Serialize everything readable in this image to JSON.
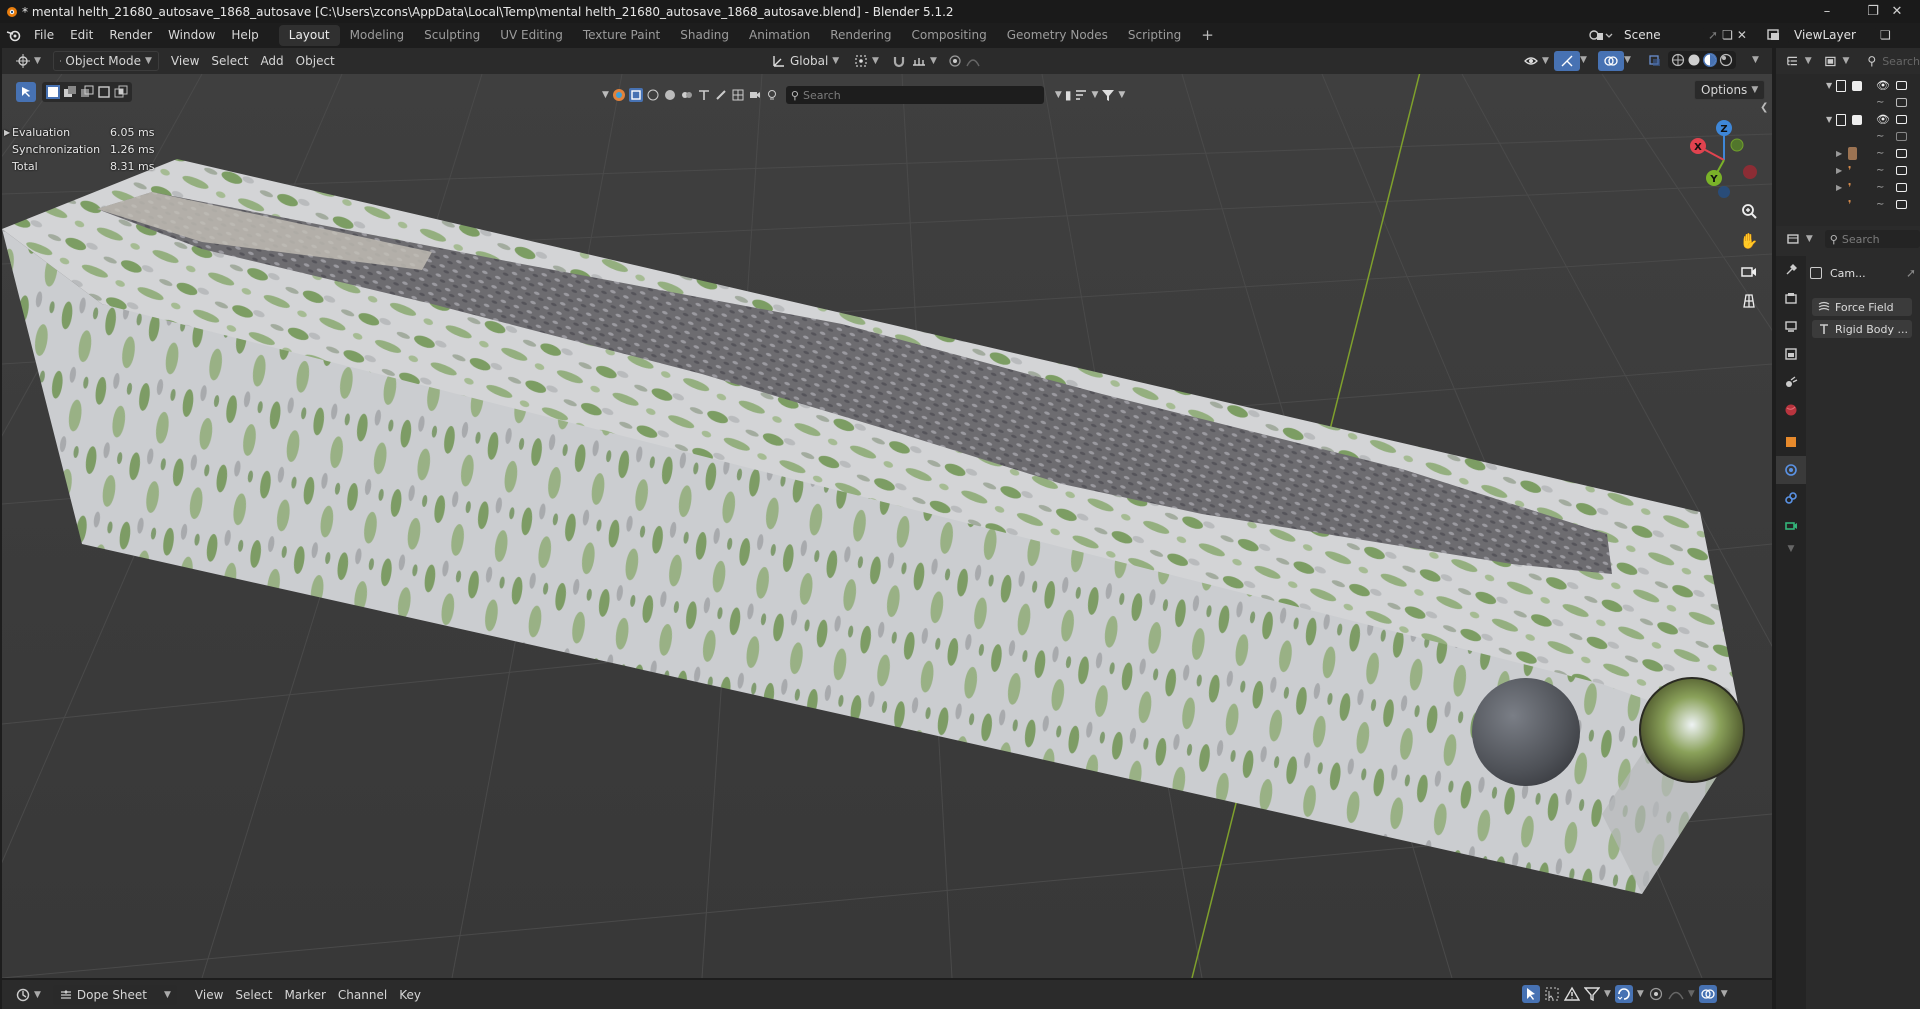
{
  "app": {
    "title": "* mental helth_21680_autosave_1868_autosave [C:\\Users\\zcons\\AppData\\Local\\Temp\\mental helth_21680_autosave_1868_autosave.blend] - Blender 5.1.2"
  },
  "menubar": {
    "menus": [
      "File",
      "Edit",
      "Render",
      "Window",
      "Help"
    ],
    "workspaces": [
      "Layout",
      "Modeling",
      "Sculpting",
      "UV Editing",
      "Texture Paint",
      "Shading",
      "Animation",
      "Rendering",
      "Compositing",
      "Geometry Nodes",
      "Scripting"
    ],
    "active_workspace": "Layout",
    "scene_name": "Scene",
    "view_layer": "ViewLayer"
  },
  "viewport_header": {
    "mode": "Object Mode",
    "menus": [
      "View",
      "Select",
      "Add",
      "Object"
    ],
    "orientation": "Global",
    "options_label": "Options",
    "search_placeholder": "Search"
  },
  "stats": [
    {
      "label": "Evaluation",
      "value": "6.05 ms"
    },
    {
      "label": "Synchronization",
      "value": "1.26 ms"
    },
    {
      "label": "Total",
      "value": "8.31 ms"
    }
  ],
  "gizmo": {
    "x": "X",
    "y": "Y",
    "z": "Z"
  },
  "timeline_header": {
    "editor": "Dope Sheet",
    "menus": [
      "View",
      "Select",
      "Marker",
      "Channel",
      "Key"
    ]
  },
  "properties": {
    "search_placeholder": "Search",
    "object_name": "Cam...",
    "buttons": [
      "Force Field",
      "Rigid Body ..."
    ]
  },
  "colors": {
    "accent": "#4772b3",
    "active_tab": "#303030",
    "header_bg": "#2b2b2b",
    "viewport_bg": "#3d3d3d",
    "axis_x": "#e0434f",
    "axis_y": "#7ab228",
    "axis_z": "#3e87d8"
  }
}
